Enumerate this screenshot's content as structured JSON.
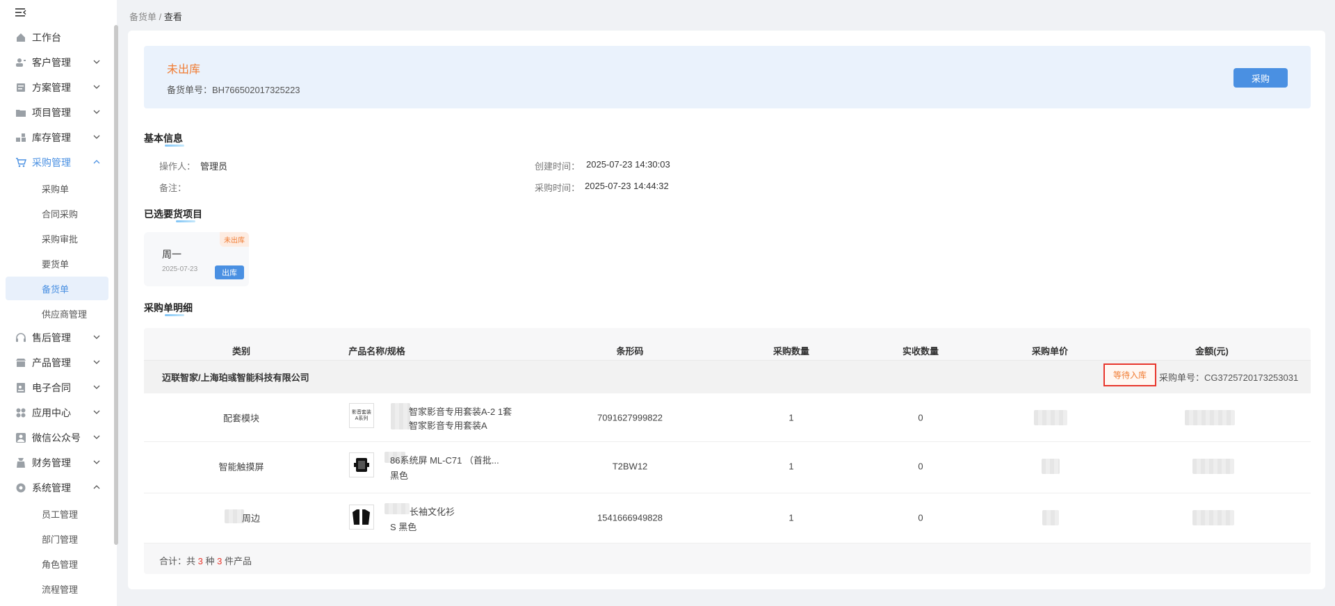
{
  "sidebar": {
    "items": [
      {
        "label": "工作台",
        "icon": "home-icon",
        "expandable": false
      },
      {
        "label": "客户管理",
        "icon": "users-icon",
        "expandable": true
      },
      {
        "label": "方案管理",
        "icon": "document-icon",
        "expandable": true
      },
      {
        "label": "项目管理",
        "icon": "folder-icon",
        "expandable": true
      },
      {
        "label": "库存管理",
        "icon": "boxes-icon",
        "expandable": true
      },
      {
        "label": "采购管理",
        "icon": "cart-icon",
        "expandable": true,
        "expanded": true
      },
      {
        "label": "售后管理",
        "icon": "headset-icon",
        "expandable": true
      },
      {
        "label": "产品管理",
        "icon": "shop-icon",
        "expandable": true
      },
      {
        "label": "电子合同",
        "icon": "contract-icon",
        "expandable": true
      },
      {
        "label": "应用中心",
        "icon": "apps-icon",
        "expandable": true
      },
      {
        "label": "微信公众号",
        "icon": "wechat-icon",
        "expandable": true
      },
      {
        "label": "财务管理",
        "icon": "finance-icon",
        "expandable": true
      },
      {
        "label": "系统管理",
        "icon": "settings-icon",
        "expandable": true,
        "expanded": true
      }
    ],
    "purchase_sub": [
      "采购单",
      "合同采购",
      "采购审批",
      "要货单",
      "备货单",
      "供应商管理"
    ],
    "active_sub": "备货单",
    "system_sub": [
      "员工管理",
      "部门管理",
      "角色管理",
      "流程管理"
    ]
  },
  "breadcrumb": {
    "parent": "备货单",
    "sep": " / ",
    "current": "查看"
  },
  "status": {
    "title": "未出库",
    "no_label": "备货单号：",
    "no_value": "BH766502017325223",
    "action": "采购"
  },
  "basic_info": {
    "title": "基本信息",
    "operator_label": "操作人：",
    "operator": "管理员",
    "remark_label": "备注：",
    "remark": "",
    "created_label": "创建时间：",
    "created": "2025-07-23 14:30:03",
    "purchase_time_label": "采购时间：",
    "purchase_time": "2025-07-23 14:44:32"
  },
  "selected_projects": {
    "title": "已选要货项目",
    "items": [
      {
        "name": "周一",
        "date": "2025-07-23",
        "badge": "未出库",
        "action": "出库"
      }
    ]
  },
  "detail": {
    "title": "采购单明细",
    "columns": [
      "类别",
      "产品名称/规格",
      "条形码",
      "采购数量",
      "实收数量",
      "采购单价",
      "金额(元)"
    ],
    "group": {
      "name": "迈联智家/上海珀彧智能科技有限公司",
      "status": "等待入库",
      "po_label": "采购单号：",
      "po_no": "CG3725720173253031"
    },
    "rows": [
      {
        "category": "配套模块",
        "name_line1": "智家影音专用套装A-2 1套",
        "name_line2": "智家影音专用套装A",
        "barcode": "7091627999822",
        "qty": "1",
        "received": "0",
        "thumb_text": "影音套装 A系列"
      },
      {
        "category": "智能触摸屏",
        "name_line1": "86系统屏 ML-C71 （首批...",
        "name_line2": "黑色",
        "barcode": "T2BW12",
        "qty": "1",
        "received": "0",
        "thumb_text": ""
      },
      {
        "category": "周边",
        "name_line1": "长袖文化衫",
        "name_line2": "S 黑色",
        "barcode": "1541666949828",
        "qty": "1",
        "received": "0",
        "thumb_text": ""
      }
    ],
    "total": {
      "prefix": "合计：共",
      "kinds": "3",
      "mid": "种",
      "pieces": "3",
      "suffix": "件产品"
    }
  }
}
